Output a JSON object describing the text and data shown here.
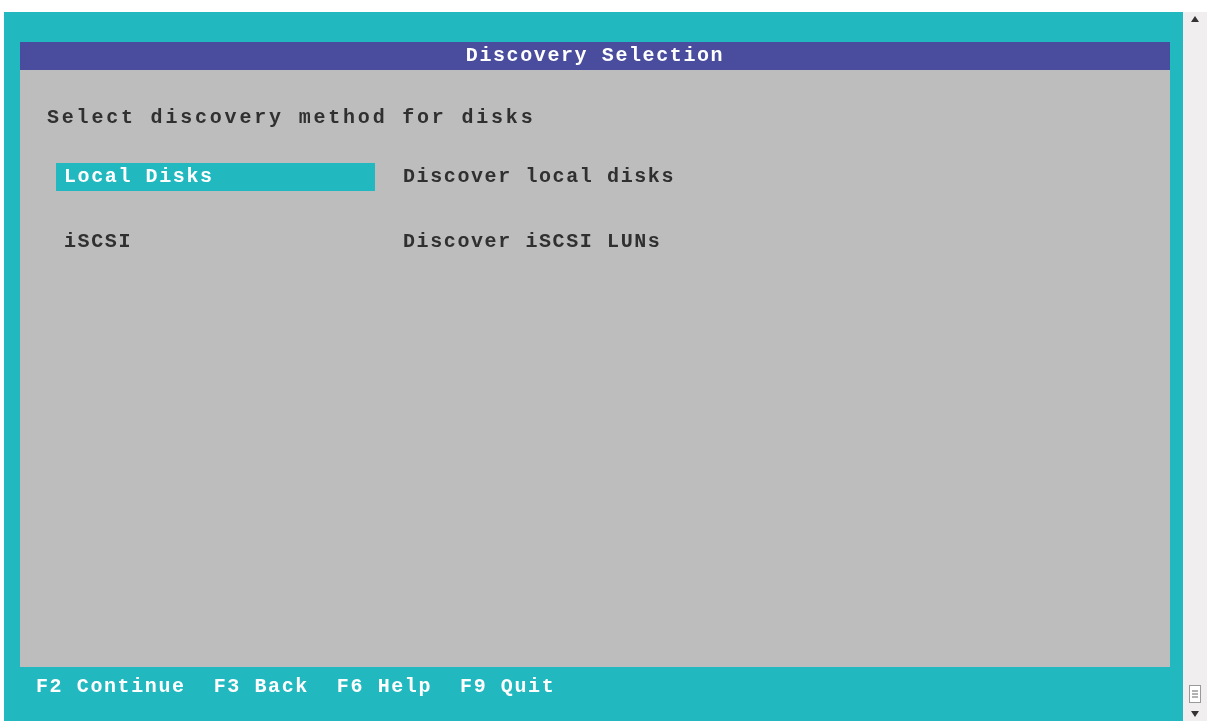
{
  "dialog": {
    "title": "Discovery Selection",
    "prompt": "Select discovery method for disks"
  },
  "options": [
    {
      "label": "Local Disks",
      "description": "Discover local disks",
      "selected": true
    },
    {
      "label": "iSCSI",
      "description": "Discover iSCSI LUNs",
      "selected": false
    }
  ],
  "function_keys": [
    "F2 Continue",
    "F3 Back",
    "F6 Help",
    "F9 Quit"
  ]
}
